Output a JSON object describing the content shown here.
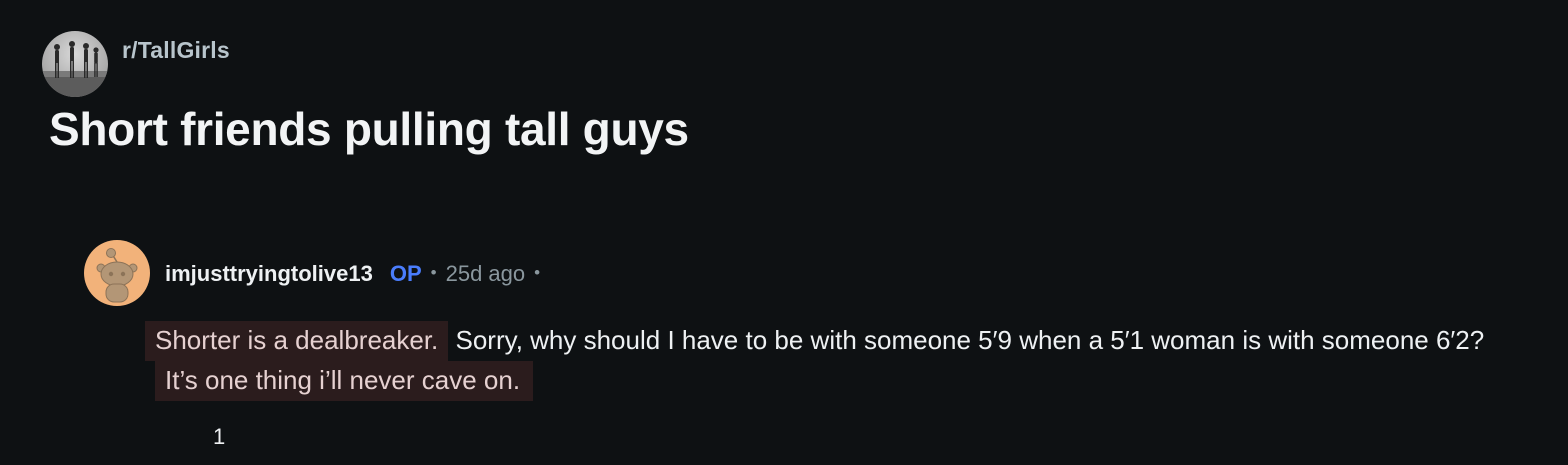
{
  "subreddit": {
    "name": "r/TallGirls",
    "avatar_icon": "subreddit-avatar-icon"
  },
  "post": {
    "title": "Short friends pulling tall guys"
  },
  "comment": {
    "author": "imjusttryingtolive13",
    "op_label": "OP",
    "separator": "•",
    "timestamp": "25d ago",
    "avatar_icon": "snoo-avatar-icon",
    "highlight_1": "Shorter is a dealbreaker.",
    "text_middle": " Sorry, why should I have to be with someone 5′9 when a 5′1 woman is with someone 6′2? ",
    "highlight_2": "It’s one thing i’ll never cave on.",
    "vote_count": "1"
  },
  "colors": {
    "background": "#0e1113",
    "op_badge": "#4a7dfc",
    "highlight_bg": "#2b1c1d",
    "muted_text": "#8a979e"
  }
}
